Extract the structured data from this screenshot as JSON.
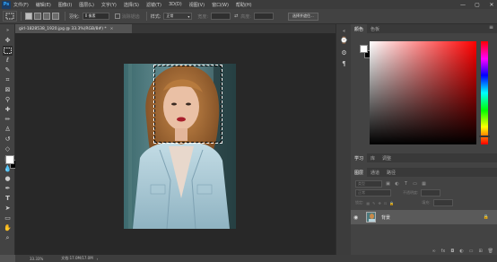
{
  "app": {
    "logo": "Ps",
    "menu": [
      "文件(F)",
      "编辑(E)",
      "图像(I)",
      "图层(L)",
      "文字(Y)",
      "选择(S)",
      "滤镜(T)",
      "3D(D)",
      "视图(V)",
      "窗口(W)",
      "帮助(H)"
    ],
    "window_controls": [
      "—",
      "▢",
      "✕"
    ]
  },
  "options": {
    "feather_label": "羽化:",
    "feather_value": "0 像素",
    "antialias_label": "消除锯齿",
    "style_label": "样式:",
    "style_value": "正常",
    "width_label": "宽度:",
    "height_label": "高度:",
    "select_mask_button": "选择并遮住..."
  },
  "document": {
    "tab_title": "girl-1828538_1920.jpg @ 33.3%(RGB/8#) *",
    "tab_close": "×"
  },
  "status": {
    "zoom": "33.33%",
    "doc_info": "文档:17.0M/17.0M"
  },
  "panels": {
    "color_tabs": [
      "颜色",
      "色板"
    ],
    "adjust_tabs": [
      "学习",
      "库",
      "调整"
    ],
    "layer_tabs": [
      "图层",
      "通道",
      "路径"
    ],
    "filter_placeholder": "类型",
    "blend_mode": "正常",
    "opacity_label": "不透明度:",
    "lock_label": "锁定:",
    "fill_label": "填充:",
    "layer_name": "背景",
    "menu_icon": "≡"
  },
  "colors": {
    "foreground": "#ffffff",
    "background": "#000000",
    "accent": "#31a8ff"
  }
}
